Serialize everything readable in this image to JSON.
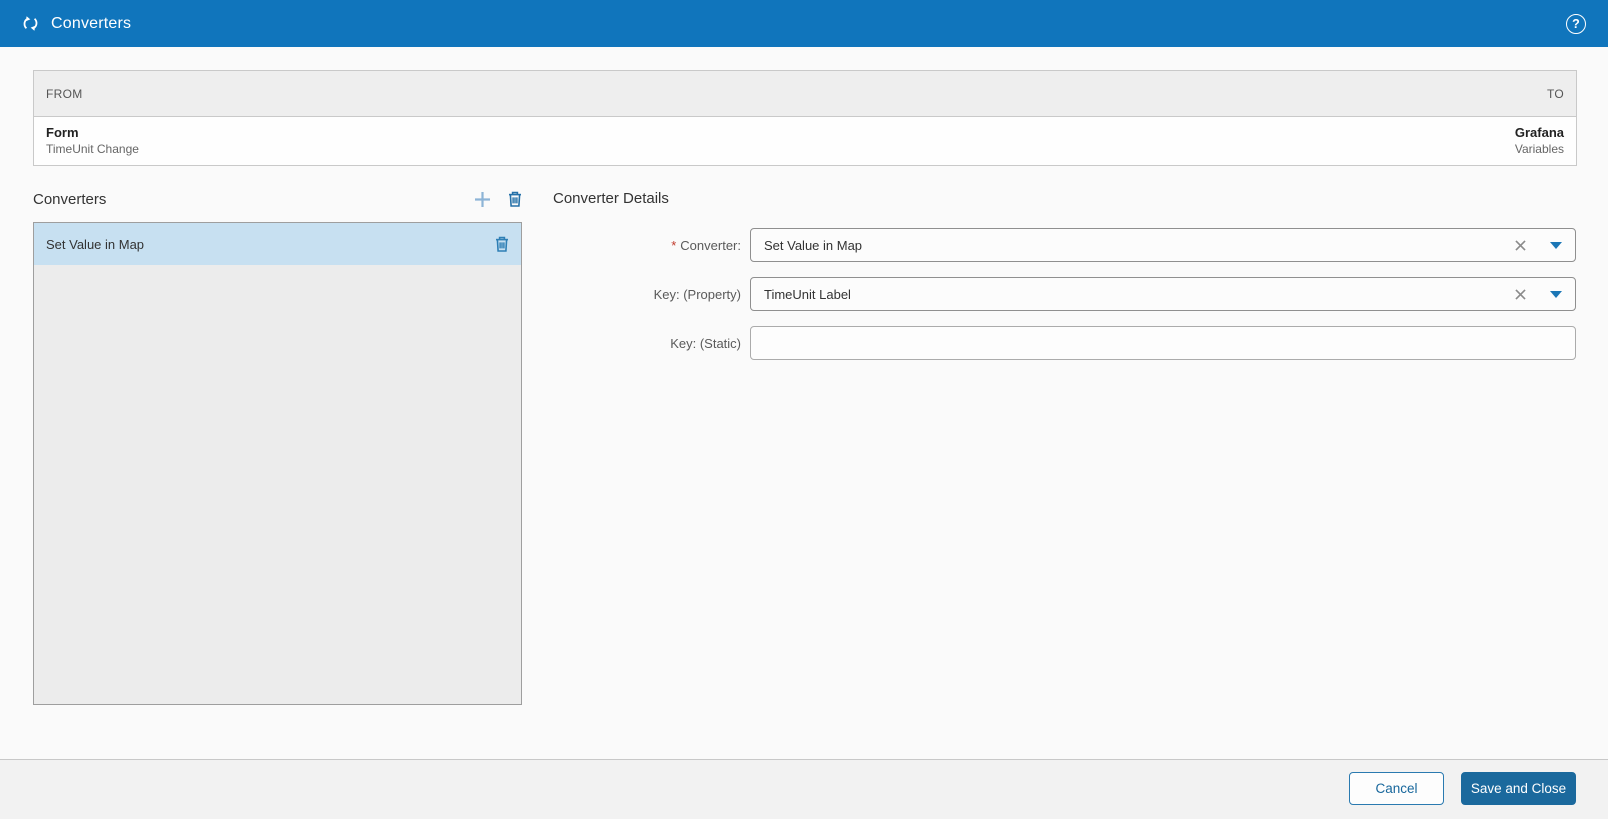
{
  "colors": {
    "header_blue": "#1075BC",
    "button_blue": "#1B699D",
    "selected_item_blue": "#C7E0F1",
    "icon_blue": "#2470A8",
    "plus_icon_blue": "#8DB4D6",
    "required_red": "#C0392B"
  },
  "header": {
    "title": "Converters"
  },
  "mapping_table": {
    "from_header": "FROM",
    "to_header": "TO",
    "row": {
      "from_title": "Form",
      "from_subtitle": "TimeUnit Change",
      "to_title": "Grafana",
      "to_subtitle": "Variables"
    }
  },
  "converters_panel": {
    "title": "Converters",
    "items": [
      {
        "label": "Set Value in Map",
        "selected": true
      }
    ]
  },
  "details": {
    "title": "Converter Details",
    "required_marker": "*",
    "fields": [
      {
        "label": "Converter:",
        "value": "Set Value in Map",
        "type": "dropdown",
        "required": true
      },
      {
        "label": "Key: (Property)",
        "value": "TimeUnit Label",
        "type": "dropdown",
        "required": false
      },
      {
        "label": "Key: (Static)",
        "value": "",
        "type": "text",
        "required": false
      }
    ]
  },
  "footer": {
    "cancel_label": "Cancel",
    "save_label": "Save and Close"
  }
}
